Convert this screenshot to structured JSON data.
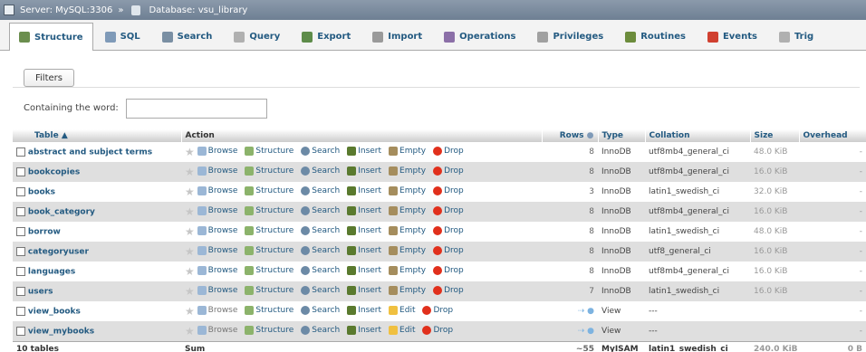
{
  "breadcrumb": {
    "server_label": "Server: MySQL:3306",
    "separator": "»",
    "database_label": "Database: vsu_library"
  },
  "tabs": [
    {
      "label": "Structure",
      "icon": "structure-icon",
      "color": "#6b8e4e",
      "active": true
    },
    {
      "label": "SQL",
      "icon": "sql-icon",
      "color": "#7f9ab8",
      "active": false
    },
    {
      "label": "Search",
      "icon": "search-icon",
      "color": "#7a8fa3",
      "active": false
    },
    {
      "label": "Query",
      "icon": "query-icon",
      "color": "#b0b0b0",
      "active": false
    },
    {
      "label": "Export",
      "icon": "export-icon",
      "color": "#5e8c4a",
      "active": false
    },
    {
      "label": "Import",
      "icon": "import-icon",
      "color": "#9a9a9a",
      "active": false
    },
    {
      "label": "Operations",
      "icon": "wrench-icon",
      "color": "#8b6fa7",
      "active": false
    },
    {
      "label": "Privileges",
      "icon": "privileges-icon",
      "color": "#a0a0a0",
      "active": false
    },
    {
      "label": "Routines",
      "icon": "routines-icon",
      "color": "#6c8c3c",
      "active": false
    },
    {
      "label": "Events",
      "icon": "clock-icon",
      "color": "#d04030",
      "active": false
    },
    {
      "label": "Trig",
      "icon": "triggers-icon",
      "color": "#b0b0b0",
      "active": false
    }
  ],
  "filters": {
    "button_label": "Filters",
    "containing_label": "Containing the word:",
    "input_value": ""
  },
  "table": {
    "headers": {
      "table": "Table",
      "action": "Action",
      "rows": "Rows",
      "type": "Type",
      "collation": "Collation",
      "size": "Size",
      "overhead": "Overhead"
    },
    "actions": {
      "browse": "Browse",
      "structure": "Structure",
      "search": "Search",
      "insert": "Insert",
      "empty": "Empty",
      "edit": "Edit",
      "drop": "Drop"
    },
    "rows": [
      {
        "name": "abstract and subject terms",
        "kind": "table",
        "rows": "8",
        "type": "InnoDB",
        "collation": "utf8mb4_general_ci",
        "size": "48.0 KiB",
        "overhead": "-"
      },
      {
        "name": "bookcopies",
        "kind": "table",
        "rows": "8",
        "type": "InnoDB",
        "collation": "utf8mb4_general_ci",
        "size": "16.0 KiB",
        "overhead": "-"
      },
      {
        "name": "books",
        "kind": "table",
        "rows": "3",
        "type": "InnoDB",
        "collation": "latin1_swedish_ci",
        "size": "32.0 KiB",
        "overhead": "-"
      },
      {
        "name": "book_category",
        "kind": "table",
        "rows": "8",
        "type": "InnoDB",
        "collation": "utf8mb4_general_ci",
        "size": "16.0 KiB",
        "overhead": "-"
      },
      {
        "name": "borrow",
        "kind": "table",
        "rows": "8",
        "type": "InnoDB",
        "collation": "latin1_swedish_ci",
        "size": "48.0 KiB",
        "overhead": "-"
      },
      {
        "name": "categoryuser",
        "kind": "table",
        "rows": "8",
        "type": "InnoDB",
        "collation": "utf8_general_ci",
        "size": "16.0 KiB",
        "overhead": "-"
      },
      {
        "name": "languages",
        "kind": "table",
        "rows": "8",
        "type": "InnoDB",
        "collation": "utf8mb4_general_ci",
        "size": "16.0 KiB",
        "overhead": "-"
      },
      {
        "name": "users",
        "kind": "table",
        "rows": "7",
        "type": "InnoDB",
        "collation": "latin1_swedish_ci",
        "size": "16.0 KiB",
        "overhead": "-"
      },
      {
        "name": "view_books",
        "kind": "view",
        "rows": "",
        "type": "View",
        "collation": "---",
        "size": "",
        "overhead": "-"
      },
      {
        "name": "view_mybooks",
        "kind": "view",
        "rows": "",
        "type": "View",
        "collation": "---",
        "size": "",
        "overhead": "-"
      }
    ],
    "footer": {
      "count": "10 tables",
      "sum_label": "Sum",
      "rows": "~55",
      "type": "MyISAM",
      "collation": "latin1_swedish_ci",
      "size": "240.0 KiB",
      "overhead": "0 B"
    }
  }
}
